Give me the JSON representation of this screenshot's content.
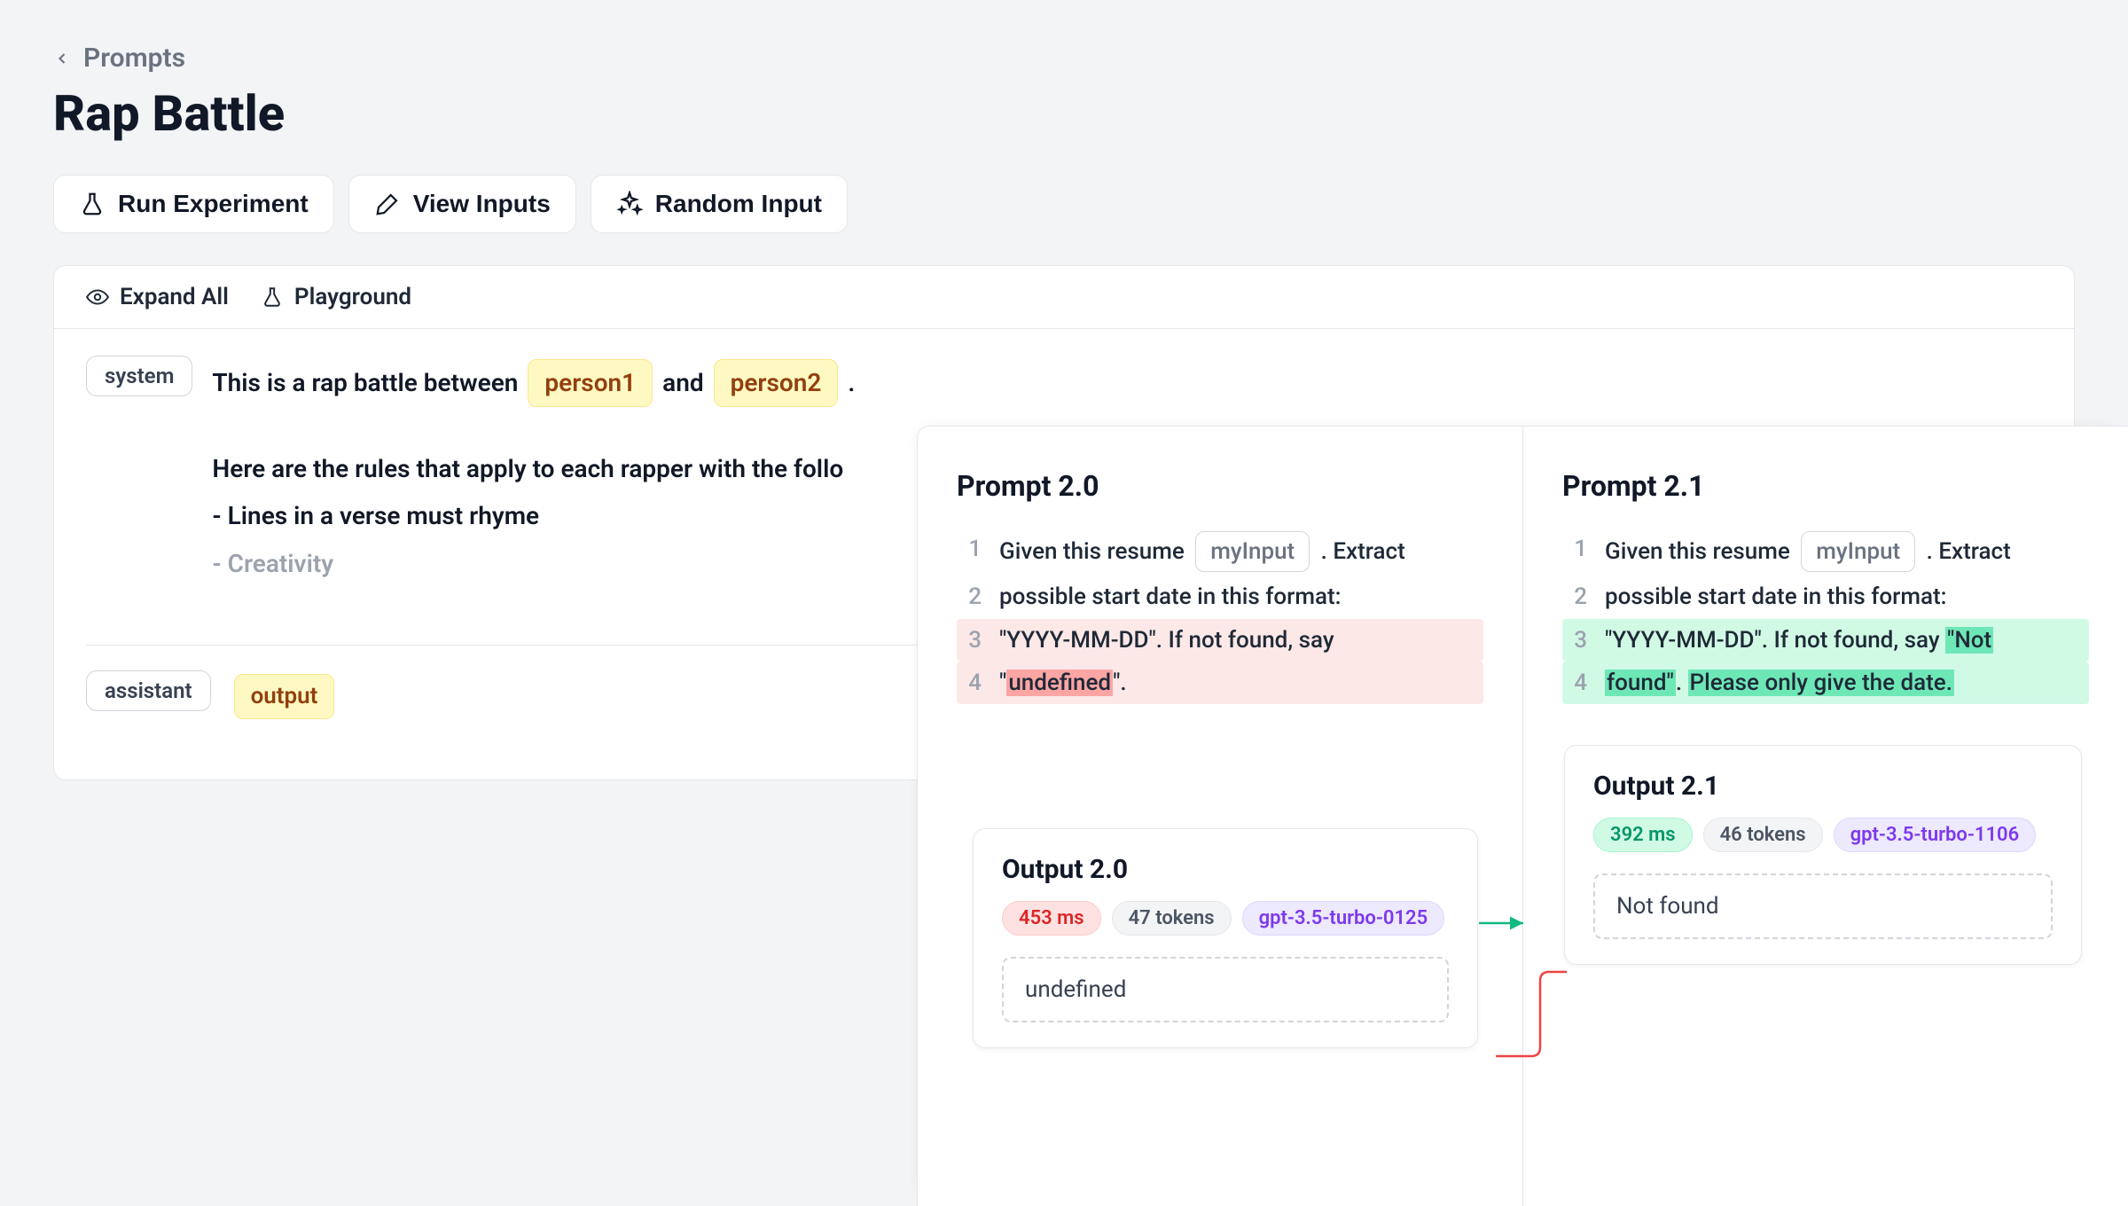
{
  "breadcrumb": {
    "label": "Prompts"
  },
  "page_title": "Rap Battle",
  "actions": {
    "run": "Run Experiment",
    "view_inputs": "View Inputs",
    "random": "Random Input"
  },
  "toolbar": {
    "expand": "Expand All",
    "playground": "Playground"
  },
  "messages": {
    "system_role": "system",
    "system_line1_pre": "This is a rap battle between ",
    "system_var1": "person1",
    "system_line1_mid": " and ",
    "system_var2": "person2",
    "system_line1_post": ".",
    "rules_header": "Here are the rules that apply to each rapper with the follo",
    "rule1": "- Lines in a verse must rhyme",
    "rule2": "- Creativity",
    "assistant_role": "assistant",
    "assistant_var": "output"
  },
  "compare": {
    "left": {
      "title": "Prompt 2.0",
      "line1_pre": "Given this resume ",
      "line1_chip": "myInput",
      "line1_post": " . Extract",
      "line2": "possible start date in this format:",
      "line3": "\"YYYY-MM-DD\". If not found, say",
      "line4_pre": "\"",
      "line4_word": "undefined",
      "line4_post": "\".",
      "output_title": "Output 2.0",
      "badge_time": "453 ms",
      "badge_tokens": "47 tokens",
      "badge_model": "gpt-3.5-turbo-0125",
      "output_text": "undefined"
    },
    "right": {
      "title": "Prompt 2.1",
      "line1_pre": "Given this resume ",
      "line1_chip": "myInput",
      "line1_post": " . Extract",
      "line2": "possible start date in this format:",
      "line3_pre": "\"YYYY-MM-DD\". If not found, say ",
      "line3_word": "\"Not",
      "line4_word1": "found\"",
      "line4_mid": ". ",
      "line4_word2": "Please only give the date.",
      "output_title": "Output 2.1",
      "badge_time": "392 ms",
      "badge_tokens": "46 tokens",
      "badge_model": "gpt-3.5-turbo-1106",
      "output_text": "Not found"
    }
  }
}
